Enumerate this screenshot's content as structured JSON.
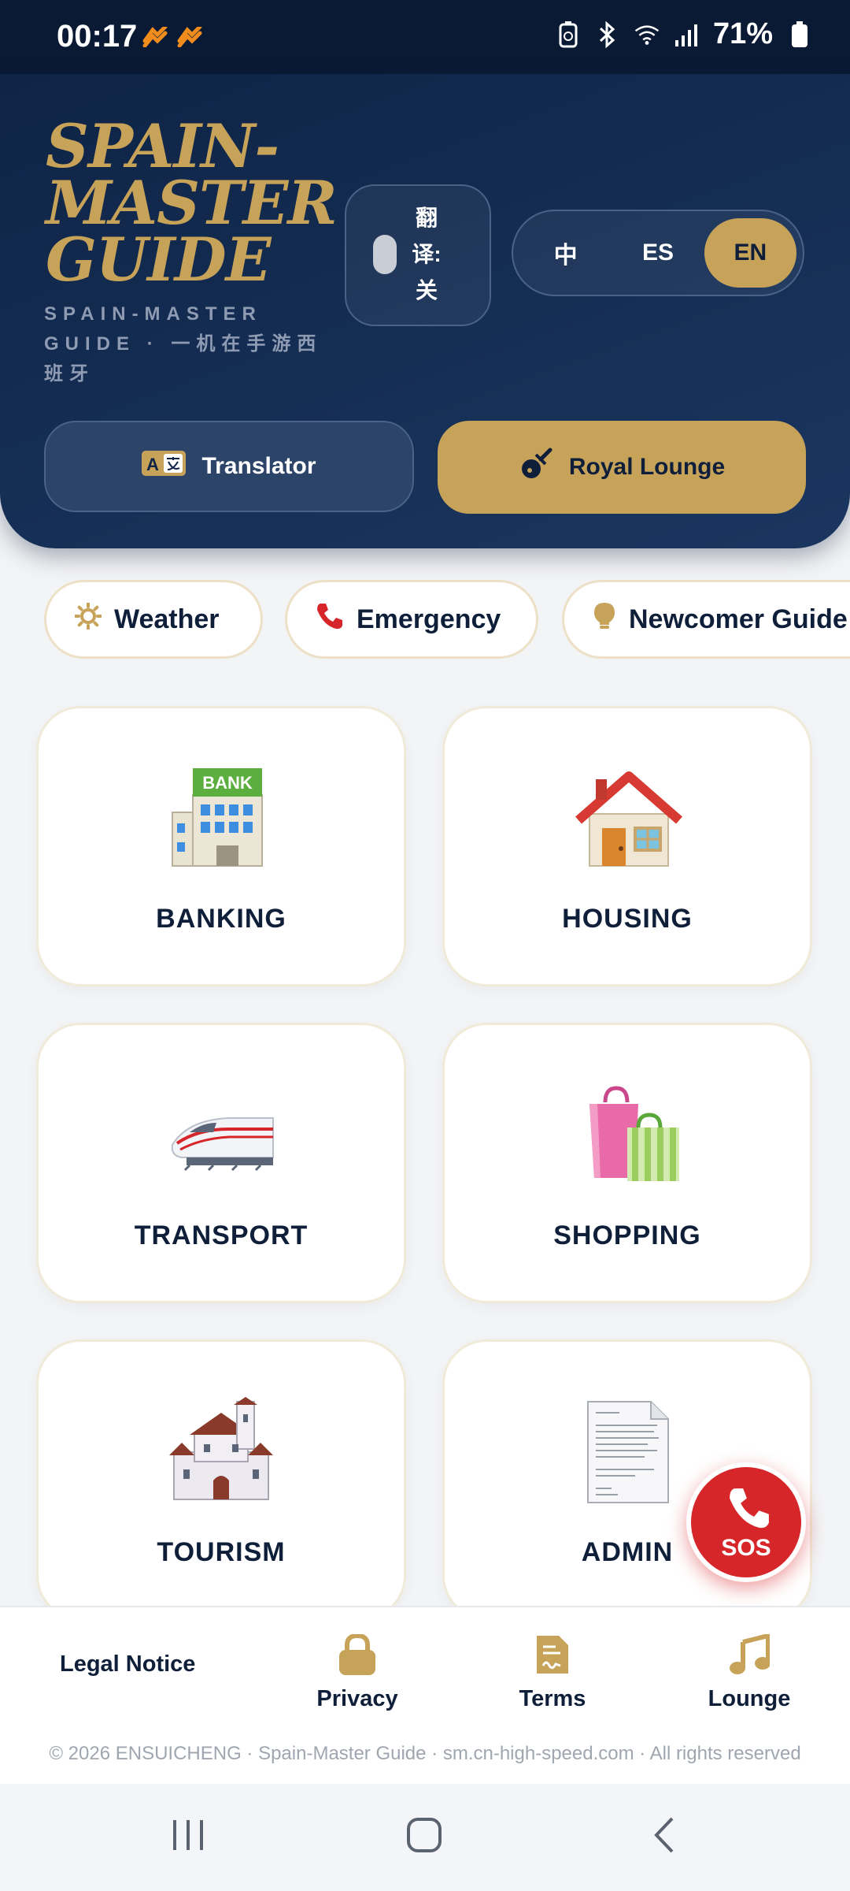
{
  "status_bar": {
    "time": "00:17",
    "battery": "71%"
  },
  "header": {
    "brand_title": "SPAIN-MASTER GUIDE",
    "brand_subtitle": "SPAIN-MASTER GUIDE · 一机在手游西班牙",
    "translate_toggle_label": "翻译:关",
    "languages": [
      "中",
      "ES",
      "EN"
    ],
    "active_language": "EN",
    "translator_button": "Translator",
    "lounge_button": "Royal Lounge"
  },
  "chips": [
    {
      "label": "Weather",
      "icon": "sun-icon"
    },
    {
      "label": "Emergency",
      "icon": "phone-icon"
    },
    {
      "label": "Newcomer Guide",
      "icon": "lightbulb-icon"
    }
  ],
  "categories": [
    {
      "label": "BANKING",
      "icon": "bank-icon"
    },
    {
      "label": "HOUSING",
      "icon": "house-icon"
    },
    {
      "label": "TRANSPORT",
      "icon": "train-icon"
    },
    {
      "label": "SHOPPING",
      "icon": "shopping-bags-icon"
    },
    {
      "label": "TOURISM",
      "icon": "castle-icon"
    },
    {
      "label": "ADMIN",
      "icon": "document-icon"
    }
  ],
  "sos": {
    "label": "SOS"
  },
  "bottom_nav": {
    "legal": "Legal Notice",
    "items": [
      {
        "label": "Privacy",
        "icon": "lock-icon"
      },
      {
        "label": "Terms",
        "icon": "contract-icon"
      },
      {
        "label": "Lounge",
        "icon": "music-note-icon"
      }
    ]
  },
  "footer": {
    "copyright": "© 2026 ENSUICHENG · Spain-Master Guide · sm.cn-high-speed.com · All rights reserved"
  },
  "colors": {
    "navy": "#0f2446",
    "gold": "#c7a35a",
    "sos_red": "#d6262a"
  }
}
